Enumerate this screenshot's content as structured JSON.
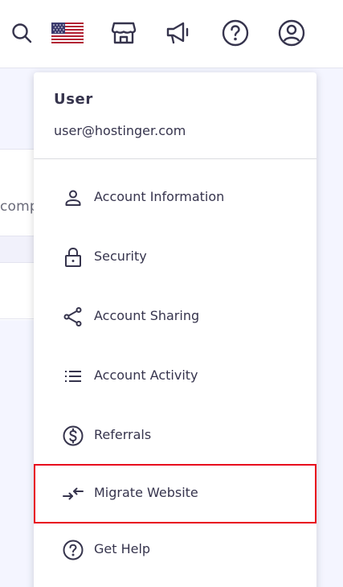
{
  "header": {
    "icons": [
      {
        "name": "search-icon"
      },
      {
        "name": "us-flag-icon"
      },
      {
        "name": "store-icon"
      },
      {
        "name": "megaphone-icon"
      },
      {
        "name": "help-icon"
      },
      {
        "name": "account-icon"
      }
    ]
  },
  "background": {
    "partial_text": "compl"
  },
  "dropdown": {
    "user_name": "User",
    "user_email": "user@hostinger.com",
    "items": [
      {
        "label": "Account Information",
        "icon": "person-icon"
      },
      {
        "label": "Security",
        "icon": "lock-icon"
      },
      {
        "label": "Account Sharing",
        "icon": "share-icon"
      },
      {
        "label": "Account Activity",
        "icon": "list-icon"
      },
      {
        "label": "Referrals",
        "icon": "dollar-circle-icon"
      },
      {
        "label": "Migrate Website",
        "icon": "migrate-arrows-icon",
        "highlighted": true
      },
      {
        "label": "Get Help",
        "icon": "help-circle-icon"
      }
    ],
    "highlight_color": "#e8001c",
    "text_color": "#36344d"
  }
}
